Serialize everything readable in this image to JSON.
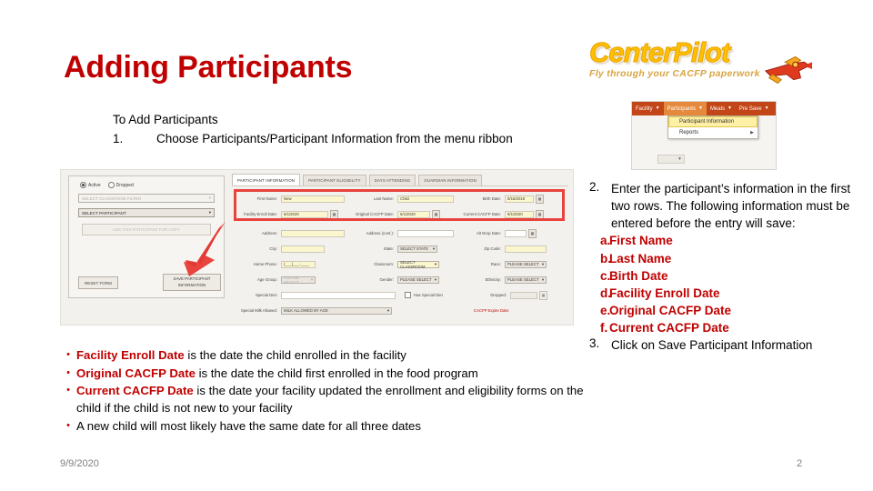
{
  "slide": {
    "title": "Adding Participants",
    "footer_date": "9/9/2020",
    "page_number": "2"
  },
  "logo": {
    "name": "Center Pilot",
    "word": "CenterPilot",
    "tagline": "Fly through your CACFP paperwork",
    "plane_icon": "airplane-icon",
    "gold": "#FFC000"
  },
  "intro": {
    "heading": "To Add Participants",
    "step_number": "1.",
    "step_text": "Choose Participants/Participant Information from the menu ribbon"
  },
  "ribbon": {
    "items": [
      {
        "label": "Facility",
        "caret": "▼"
      },
      {
        "label": "Participants",
        "caret": "▼"
      },
      {
        "label": "Meals",
        "caret": "▼"
      },
      {
        "label": "Pre Save",
        "caret": "▼"
      }
    ],
    "menu": {
      "highlighted": "Participant Information",
      "second": "Reports",
      "submenu_caret": "▶"
    },
    "stub_caret": "▼",
    "bar_color": "#C24617",
    "active_color": "#E58A3C",
    "highlight_color": "#FFF0A8"
  },
  "app": {
    "left_panel": {
      "radio_active": "Active",
      "radio_dropped": "Dropped",
      "classroom_filter": "SELECT CLASSROOM FILTER",
      "select_participant": "SELECT PARTICIPANT",
      "use_participant": "USE THIS PARTICIPANT FOR COPY",
      "reset_button": "RESET FORM",
      "save_button_line1": "SAVE PARTICIPANT",
      "save_button_line2": "INFORMATION",
      "arrow_icon": "red-arrow-icon"
    },
    "tabs": [
      {
        "label": "PARTICIPANT INFORMATION",
        "selected": true
      },
      {
        "label": "PARTICIPANT ELIGIBILITY",
        "selected": false
      },
      {
        "label": "DAYS ATTENDING",
        "selected": false
      },
      {
        "label": "GUARDIAN INFORMATION",
        "selected": false
      }
    ],
    "fields": {
      "first_name_label": "First Name:",
      "first_name_value": "New",
      "last_name_label": "Last Name:",
      "last_name_value": "Child",
      "birth_date_label": "Birth Date:",
      "birth_date_value": "8/15/2018",
      "facility_enroll_label": "Facility Enroll Date:",
      "facility_enroll_value": "6/1/2020",
      "original_cacfp_label": "Original CACFP Date:",
      "original_cacfp_value": "6/1/2020",
      "current_cacfp_label": "Current CACFP Date:",
      "current_cacfp_value": "9/1/2020",
      "address_label": "Address:",
      "address_value": "",
      "address_cont_label": "Address (cont.):",
      "address_cont_value": "",
      "alt_drop_label": "Alt Drop Date:",
      "alt_drop_value": "",
      "city_label": "City:",
      "city_value": "",
      "state_label": "State:",
      "state_value": "SELECT STATE",
      "zip_label": "Zip Code:",
      "zip_value": "",
      "home_phone_label": "Home Phone:",
      "home_phone_value": "(___)___-____",
      "classroom_label": "Classroom:",
      "classroom_value": "SELECT CLASSROOM",
      "race_label": "Race:",
      "race_value": "PLEASE SELECT",
      "age_group_label": "Age Group:",
      "age_group_value": "PLEASE SELECT",
      "gender_label": "Gender:",
      "gender_value": "PLEASE SELECT",
      "ethnicity_label": "Ethnicity:",
      "ethnicity_value": "PLEASE SELECT",
      "special_diet_label": "Special Diet:",
      "special_diet_value": "",
      "has_special_diet_label": "Has Special Diet",
      "dropped_label": "Dropped:",
      "dropped_value": "",
      "special_milk_label": "Special Milk Allowed:",
      "special_milk_value": "MILK ALLOWED BY AGE",
      "cacfp_expire_label": "CACFP Expire Date:",
      "calendar_icon": "Ὄ5"
    },
    "highlight_border_color": "#E8433C"
  },
  "right_column": {
    "step2_num": "2.",
    "step2_text": "Enter the participant’s information in the first two rows. The following information must be entered before the entry will save:",
    "sub_items": [
      {
        "marker": "a.",
        "label": "First Name"
      },
      {
        "marker": "b.",
        "label": "Last Name"
      },
      {
        "marker": "c.",
        "label": "Birth Date"
      },
      {
        "marker": "d.",
        "label": "Facility Enroll Date"
      },
      {
        "marker": "e.",
        "label": "Original CACFP Date"
      },
      {
        "marker": "f.",
        "label": "Current CACFP Date"
      }
    ],
    "step3_num": "3.",
    "step3_text": "Click on Save Participant Information"
  },
  "bottom_bullets": [
    {
      "bullet": "•",
      "term": "Facility Enroll Date",
      "rest": " is the date the child enrolled in the facility"
    },
    {
      "bullet": "•",
      "term": "Original CACFP Date",
      "rest": " is the date the child first enrolled in the food program"
    },
    {
      "bullet": "•",
      "term": "Current CACFP Date",
      "rest": " is the date your facility updated the enrollment and eligibility forms on the child if the child is not new to your facility"
    },
    {
      "bullet": "•",
      "term": "",
      "rest": "A new child will most likely have the same date for all three dates"
    }
  ]
}
